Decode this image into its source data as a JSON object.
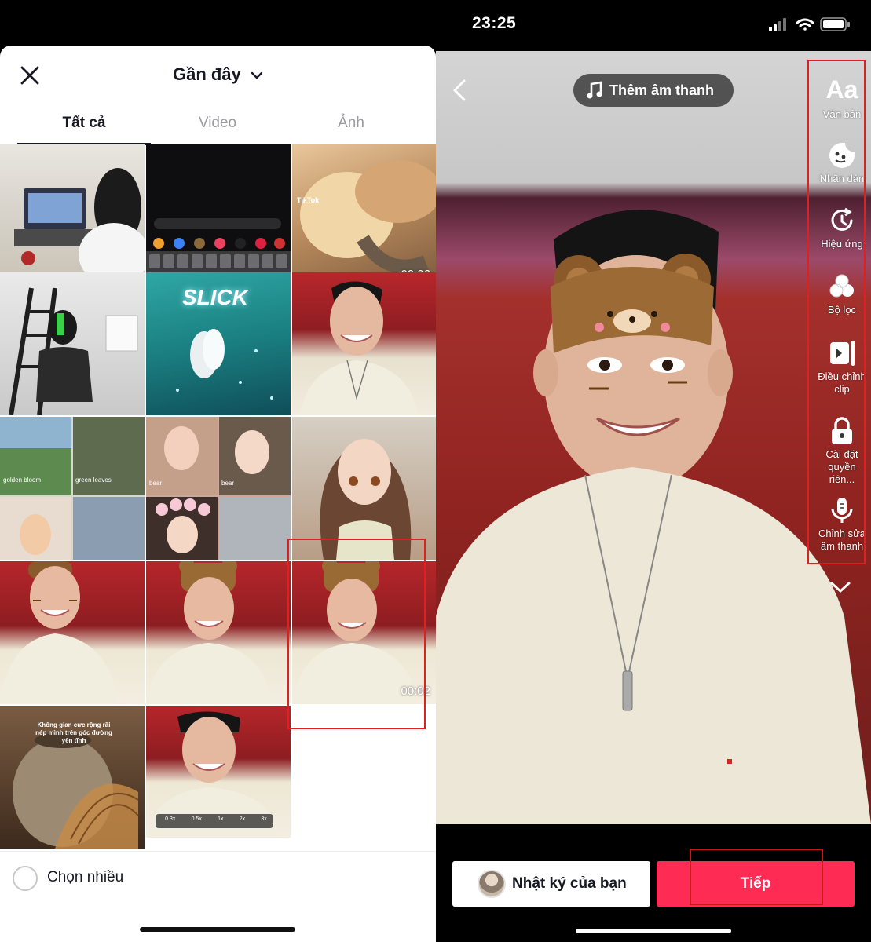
{
  "status_bar": {
    "time": "23:25"
  },
  "picker": {
    "title": "Gần đây",
    "tabs": [
      {
        "label": "Tất cả",
        "active": true
      },
      {
        "label": "Video",
        "active": false
      },
      {
        "label": "Ảnh",
        "active": false
      }
    ],
    "thumb_texts": {
      "dur_1": "00:06",
      "dur_2": "00:02",
      "slick": "SLICK",
      "golden_bloom": "golden bloom",
      "green_leaves": "green leaves",
      "bear_1": "bear",
      "bear_2": "bear",
      "caption": "Không gian cực rộng rãi nép mình trên góc đường yên tĩnh",
      "tiktok": "TikTok",
      "speeds": [
        "0.3x",
        "0.5x",
        "1x",
        "2x",
        "3x"
      ]
    },
    "multi_select_label": "Chọn nhiều"
  },
  "editor": {
    "add_sound_label": "Thêm âm thanh",
    "tools": [
      {
        "icon": "text-aa-icon",
        "label": "Văn bản"
      },
      {
        "icon": "sticker-icon",
        "label": "Nhãn dán"
      },
      {
        "icon": "effects-icon",
        "label": "Hiệu ứng"
      },
      {
        "icon": "filters-icon",
        "label": "Bộ lọc"
      },
      {
        "icon": "adjust-clip-icon",
        "label": "Điều chỉnh clip"
      },
      {
        "icon": "lock-icon",
        "label": "Cài đặt quyền riên..."
      },
      {
        "icon": "voice-edit-icon",
        "label": "Chỉnh sửa âm thanh"
      }
    ],
    "text_tool_glyph": "Aa",
    "diary_label": "Nhật ký của bạn",
    "next_label": "Tiếp"
  },
  "colors": {
    "accent": "#fe2c55",
    "highlight": "#e02020"
  }
}
